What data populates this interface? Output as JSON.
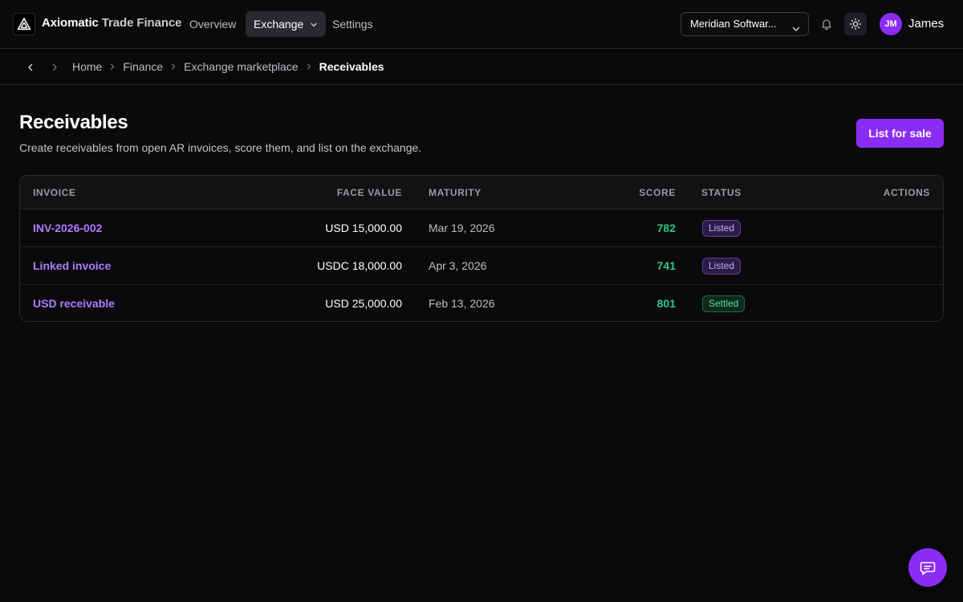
{
  "header": {
    "brand_primary": "Axiomatic",
    "brand_secondary": "Trade Finance",
    "logo_icon": "triangle-logo-icon",
    "nav": [
      {
        "label": "Overview"
      },
      {
        "label": "Exchange",
        "active": true,
        "has_dropdown": true
      },
      {
        "label": "Settings"
      }
    ],
    "org_selector": "Meridian Softwar...",
    "notification_icon": "bell-icon",
    "theme_icon": "sun-icon",
    "user": {
      "initials": "JM",
      "name": "James"
    }
  },
  "breadcrumb": {
    "back_icon": "chevron-left-icon",
    "forward_icon": "chevron-right-icon",
    "items": [
      "Home",
      "Finance",
      "Exchange marketplace",
      "Receivables"
    ]
  },
  "page": {
    "title": "Receivables",
    "subtitle": "Create receivables from open AR invoices, score them, and list on the exchange.",
    "primary_action": "List for sale"
  },
  "table": {
    "columns": [
      "INVOICE",
      "FACE VALUE",
      "MATURITY",
      "SCORE",
      "STATUS",
      "ACTIONS"
    ],
    "rows": [
      {
        "invoice": "INV-2026-002",
        "face_value": "USD 15,000.00",
        "maturity": "Mar 19, 2026",
        "score": "782",
        "status": "Listed"
      },
      {
        "invoice": "Linked invoice",
        "face_value": "USDC 18,000.00",
        "maturity": "Apr 3, 2026",
        "score": "741",
        "status": "Listed"
      },
      {
        "invoice": "USD receivable",
        "face_value": "USD 25,000.00",
        "maturity": "Feb 13, 2026",
        "score": "801",
        "status": "Settled"
      }
    ]
  },
  "chat_icon": "chat-bubble-icon",
  "colors": {
    "accent": "#8b2cf5",
    "link": "#b07cff",
    "score": "#2dcb86",
    "background": "#0a0a0c"
  }
}
